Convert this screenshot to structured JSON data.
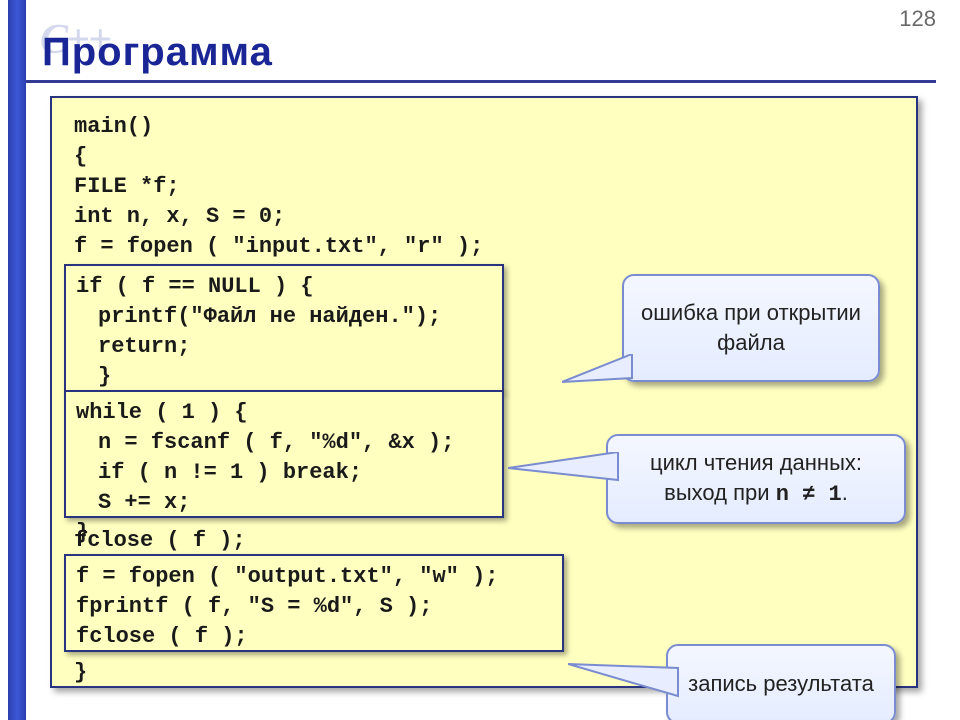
{
  "pageNumber": "128",
  "title": "Программа",
  "watermark": "C++",
  "code": {
    "line1": "main()",
    "line2": "{",
    "line3": "FILE *f;",
    "line4": "int n, x, S = 0;",
    "line5": "f = fopen ( \"input.txt\", \"r\" );",
    "box1": {
      "l1": "if ( f == NULL ) {",
      "l2": "printf(\"Файл не найден.\");",
      "l3": "return;",
      "l4": "}"
    },
    "box2": {
      "l1": "while ( 1 ) {",
      "l2": "n = fscanf ( f, \"%d\", &x );",
      "l3": "if ( n != 1 ) break;",
      "l4": "S += x;",
      "l5": "}"
    },
    "line6": "fclose ( f );",
    "box3": {
      "l1": "f = fopen ( \"output.txt\", \"w\" );",
      "l2": "fprintf ( f, \"S = %d\", S );",
      "l3": "fclose ( f );"
    },
    "line7": "}"
  },
  "callouts": {
    "c1": "ошибка при открытии файла",
    "c2a": "цикл чтения данных:",
    "c2b_prefix": "выход при ",
    "c2b_mono": "n ≠ 1",
    "c2b_suffix": ".",
    "c3": "запись результата"
  }
}
